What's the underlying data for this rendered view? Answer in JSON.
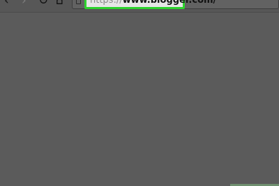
{
  "toolbar": {
    "icons": {
      "back": "back-arrow-icon",
      "forward": "forward-arrow-icon",
      "reload": "reload-icon",
      "home": "home-icon"
    },
    "address_bar": {
      "url_prefix": "https://",
      "url_main": "www.blogger.com/",
      "highlight_color": "#2ed32e"
    }
  },
  "colors": {
    "page_background": "#5b5b5b"
  }
}
